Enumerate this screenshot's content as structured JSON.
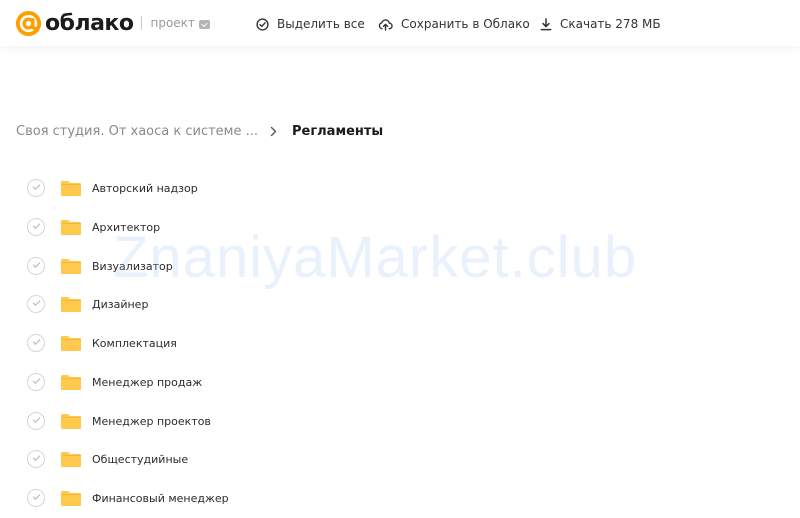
{
  "header": {
    "logo_text": "облако",
    "project_label": "проект",
    "actions": {
      "select_all": "Выделить все",
      "save_to_cloud": "Сохранить в Облако",
      "download": "Скачать 278 МБ"
    }
  },
  "breadcrumb": {
    "parent": "Своя студия. От хаоса к системе ...",
    "current": "Регламенты"
  },
  "items": [
    {
      "name": "Авторский надзор"
    },
    {
      "name": "Архитектор"
    },
    {
      "name": "Визуализатор"
    },
    {
      "name": "Дизайнер"
    },
    {
      "name": "Комплектация"
    },
    {
      "name": "Менеджер продаж"
    },
    {
      "name": "Менеджер проектов"
    },
    {
      "name": "Общестудийные"
    },
    {
      "name": "Финансовый менеджер"
    }
  ],
  "watermark": "ZnaniyaMarket.club",
  "colors": {
    "brand_orange": "#FF9E00",
    "folder_yellow": "#FFC94D",
    "folder_tab": "#F5B63A"
  },
  "icons": {
    "logo": "at-sign-logo-icon",
    "select_all": "check-circle-icon",
    "save": "cloud-upload-icon",
    "download": "download-icon",
    "breadcrumb_separator": "chevron-right-icon",
    "folder": "folder-icon",
    "checkbox": "checkmark-circle-icon"
  }
}
